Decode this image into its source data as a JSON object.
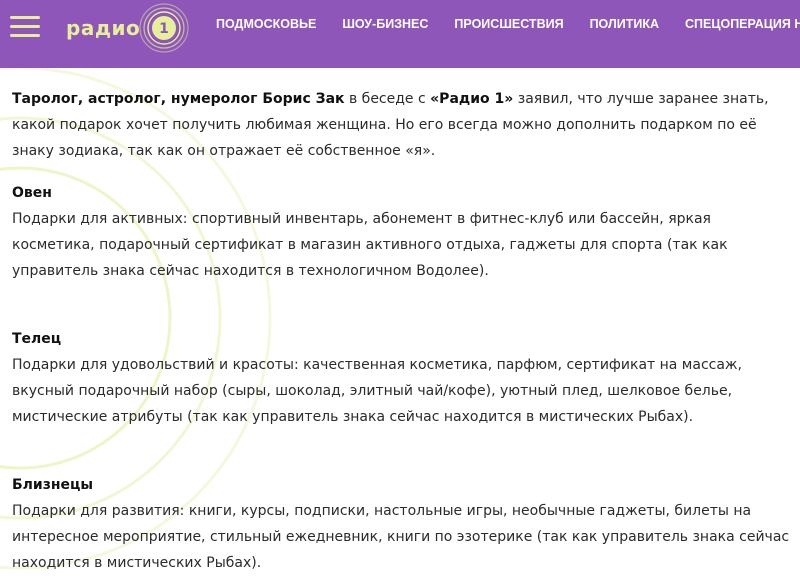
{
  "header": {
    "logo_text": "радио",
    "logo_number": "1",
    "nav": [
      "ПОДМОСКОВЬЕ",
      "ШОУ-БИЗНЕС",
      "ПРОИСШЕСТВИЯ",
      "ПОЛИТИКА",
      "СПЕЦОПЕРАЦИЯ НА УКРАИНЕ"
    ],
    "icons": [
      "menu-icon",
      "logo-circle-icon"
    ]
  },
  "article": {
    "intro_bold": "Таролог, астролог, нумеролог Борис Зак",
    "intro_mid": " в беседе с ",
    "intro_radio": "«Радио 1»",
    "intro_rest": " заявил, что лучше заранее знать, какой подарок хочет получить любимая женщина. Но его всегда можно дополнить подарком по её знаку зодиака, так как он отражает её собственное «я».",
    "signs": [
      {
        "title": "Овен",
        "text": "Подарки для активных: спортивный инвентарь, абонемент в фитнес-клуб или бассейн, яркая косметика, подарочный сертификат в магазин активного отдыха, гаджеты для спорта (так как управитель знака сейчас находится в технологичном Водолее)."
      },
      {
        "title": "Телец",
        "text": "Подарки для удовольствий и красоты: качественная косметика, парфюм, сертификат на массаж, вкусный подарочный набор (сыры, шоколад, элитный чай/кофе), уютный плед, шелковое белье, мистические атрибуты (так как управитель знака сейчас находится в мистических Рыбах)."
      },
      {
        "title": "Близнецы",
        "text": "Подарки для развития: книги, курсы, подписки, настольные игры, необычные гаджеты, билеты на интересное мероприятие, стильный ежедневник, книги по эзотерике (так как управитель знака сейчас находится в мистических Рыбах)."
      }
    ]
  },
  "colors": {
    "header_bg": "#8e56b8",
    "accent": "#e6f09a",
    "text": "#2b2b2b"
  }
}
